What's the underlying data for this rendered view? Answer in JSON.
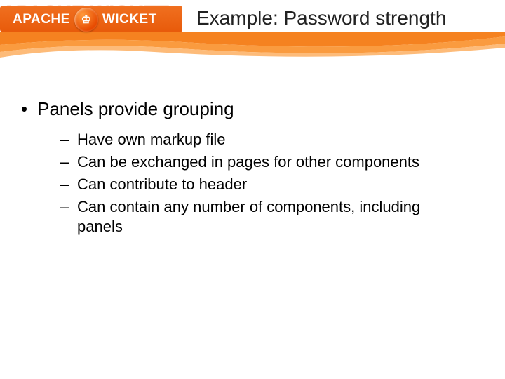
{
  "logo": {
    "ghost": "APACHE WICKET",
    "word_left": "APACHE",
    "word_right": "WICKET",
    "circle_glyph": "♔"
  },
  "title": "Example: Password strength",
  "bullet_main": "Panels provide grouping",
  "sub_items": [
    "Have own markup file",
    "Can be exchanged in pages for other components",
    "Can contribute to header",
    "Can contain any number of components, including panels"
  ]
}
